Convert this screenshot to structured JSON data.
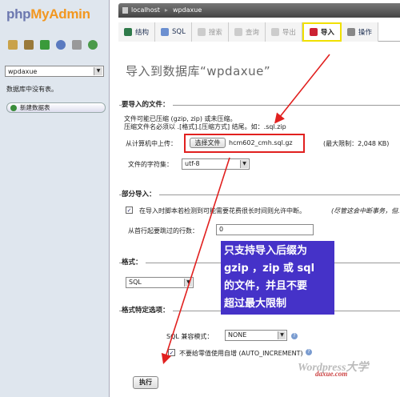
{
  "sidebar": {
    "logo_php": "php",
    "logo_myadmin": "MyAdmin",
    "db_selected": "wpdaxue",
    "no_tables": "数据库中没有表。",
    "new_table": "新建数据表"
  },
  "breadcrumb": {
    "server": "localhost",
    "database": "wpdaxue"
  },
  "tabs": [
    {
      "label": "结构"
    },
    {
      "label": "SQL"
    },
    {
      "label": "搜索"
    },
    {
      "label": "查询"
    },
    {
      "label": "导出"
    },
    {
      "label": "导入"
    },
    {
      "label": "操作"
    }
  ],
  "title": "导入到数据库“wpdaxue”",
  "file_section": {
    "legend": "要导入的文件：",
    "line1": "文件可能已压缩 (gzip, zip) 或未压缩。",
    "line2": "压缩文件名必须以 .[格式].[压缩方式] 结尾。如：.sql.zip",
    "upload_label": "从计算机中上传：",
    "choose_button": "选择文件",
    "filename": "hcm602_cmh.sql.gz",
    "max_limit": "(最大限制：2,048 KB)",
    "charset_label": "文件的字符集：",
    "charset_value": "utf-8"
  },
  "partial": {
    "legend": "部分导入：",
    "allow_interrupt": "在导入时脚本若检测到可能需要花费很长时间则允许中断。",
    "interrupt_note": "(尽管这会中断事务，但...",
    "skip_label": "从首行起要跳过的行数：",
    "skip_value": "0"
  },
  "format": {
    "legend": "格式：",
    "value": "SQL"
  },
  "format_options": {
    "legend": "格式特定选项：",
    "compat_label": "SQL 兼容模式：",
    "compat_value": "NONE",
    "auto_inc_label": "不要给零值使用自增 (AUTO_INCREMENT)"
  },
  "submit_label": "执行",
  "annotation": {
    "line1": "只支持导入后缀为",
    "line2": "gzip ，zip 或 sql",
    "line3": "的文件，并且不要",
    "line4": "超过最大限制"
  },
  "watermark": {
    "main": "Wordpress大学",
    "sub": "daxue.com"
  }
}
